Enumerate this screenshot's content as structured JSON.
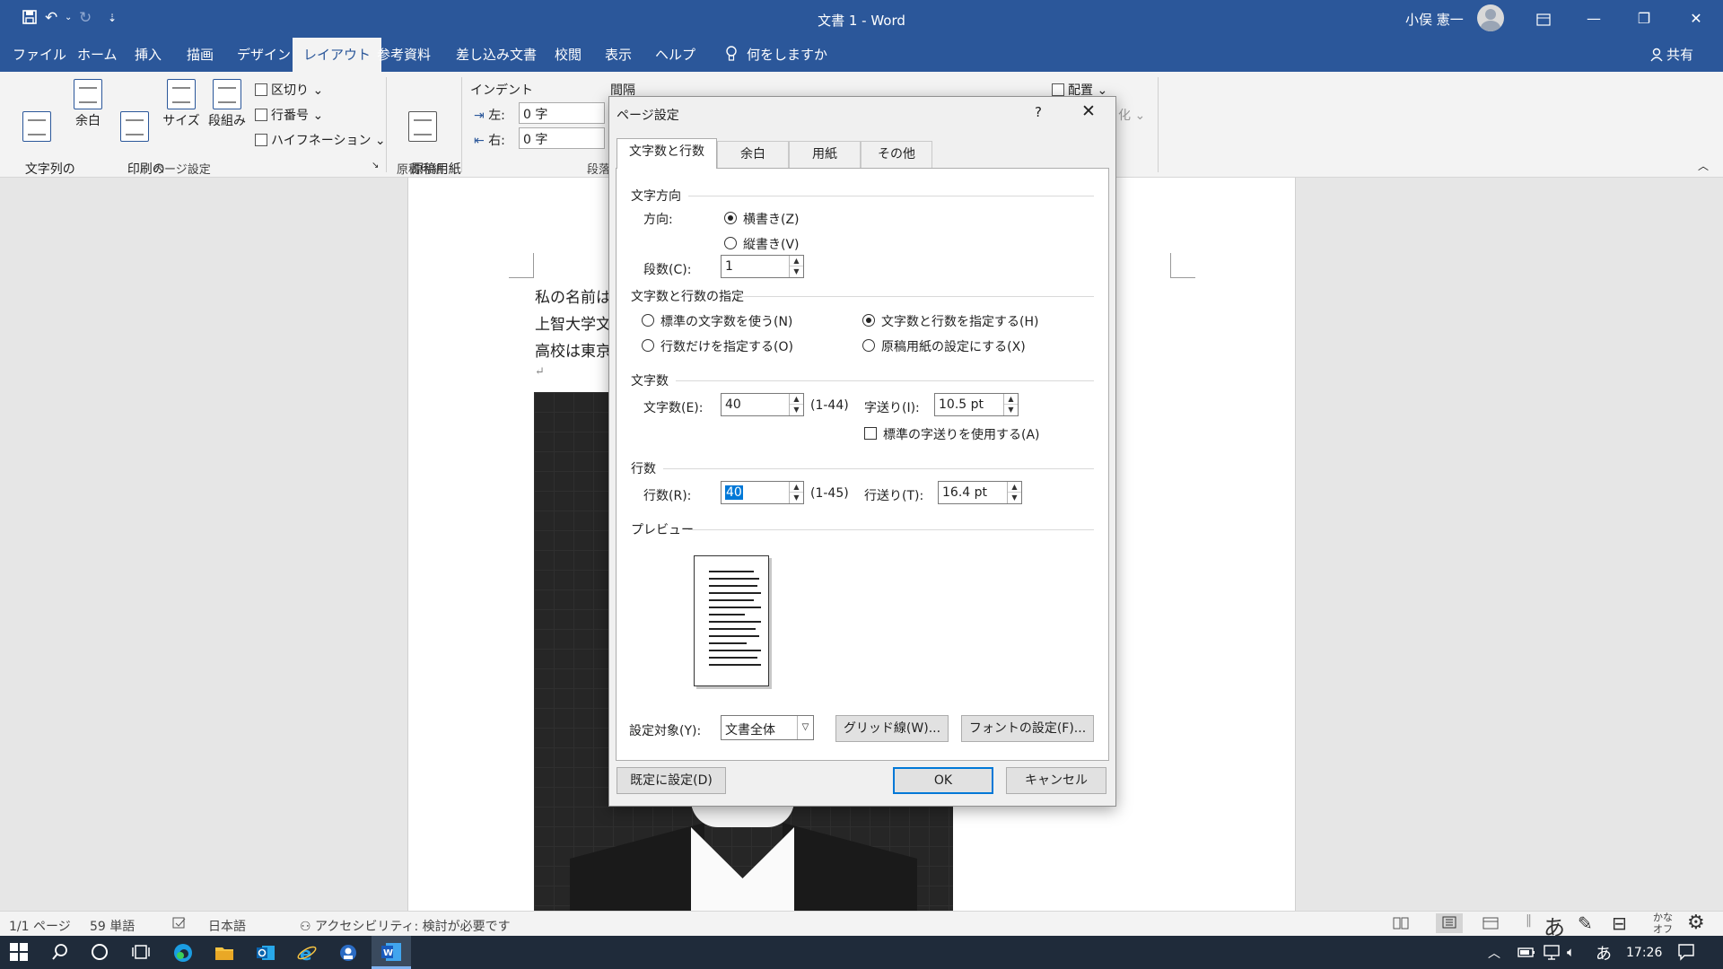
{
  "titlebar": {
    "doc_title": "文書 1  -  Word",
    "user_name": "小俣 憲一",
    "undo_glyph": "↶",
    "redo_glyph": "↻",
    "customize_glyph": "⇣"
  },
  "tabs": [
    "ファイル",
    "ホーム",
    "挿入",
    "描画",
    "デザイン",
    "レイアウト",
    "参考資料",
    "差し込み文書",
    "校閲",
    "表示",
    "ヘルプ"
  ],
  "active_tab": "レイアウト",
  "tell_me": "何をしますか",
  "share_label": "共有",
  "ribbon": {
    "text_direction": "文字列の\n方向",
    "margins": "余白",
    "orientation": "印刷の\n向き",
    "size": "サイズ",
    "columns": "段組み",
    "breaks": "区切り",
    "line_numbers": "行番号",
    "hyphenation": "ハイフネーション",
    "page_setup_group": "ページ設定",
    "genko": "原稿用紙\n設定",
    "genko_group": "原稿用紙",
    "indent_header": "インデント",
    "indent_left_label": "左:",
    "indent_left_value": "0 字",
    "indent_right_label": "右:",
    "indent_right_value": "0 字",
    "spacing_header": "間隔",
    "paragraph_group": "段落",
    "arrange": "配置",
    "ka": "化"
  },
  "document": {
    "lines": [
      "私の名前は",
      "上智大学文",
      "高校は東京"
    ],
    "para_mark": "↵"
  },
  "dialog": {
    "title": "ページ設定",
    "help": "?",
    "close": "✕",
    "tabs": [
      "文字数と行数",
      "余白",
      "用紙",
      "その他"
    ],
    "text_direction": {
      "header": "文字方向",
      "direction_label": "方向:",
      "horizontal": "横書き(Z)",
      "vertical": "縦書き(V)",
      "selected": "横書き(Z)",
      "columns_label": "段数(C):",
      "columns_value": "1"
    },
    "grid": {
      "header": "文字数と行数の指定",
      "opt_standard": "標準の文字数を使う(N)",
      "opt_chars_lines": "文字数と行数を指定する(H)",
      "opt_lines_only": "行数だけを指定する(O)",
      "opt_genko": "原稿用紙の設定にする(X)",
      "selected": "文字数と行数を指定する(H)"
    },
    "chars": {
      "header": "文字数",
      "chars_label": "文字数(E):",
      "chars_value": "40",
      "chars_range": "(1-44)",
      "pitch_label": "字送り(I):",
      "pitch_value": "10.5 pt",
      "use_standard_pitch": "標準の字送りを使用する(A)",
      "use_standard_pitch_checked": false
    },
    "lines": {
      "header": "行数",
      "lines_label": "行数(R):",
      "lines_value": "40",
      "lines_range": "(1-45)",
      "pitch_label": "行送り(T):",
      "pitch_value": "16.4 pt"
    },
    "preview_header": "プレビュー",
    "apply_to_label": "設定対象(Y):",
    "apply_to_value": "文書全体",
    "grid_button": "グリッド線(W)...",
    "font_button": "フォントの設定(F)...",
    "default_button": "既定に設定(D)",
    "ok_button": "OK",
    "cancel_button": "キャンセル"
  },
  "statusbar": {
    "page": "1/1 ページ",
    "words": "59 単語",
    "language": "日本語",
    "accessibility": "アクセシビリティ: 検討が必要です",
    "ime_mode": "あ",
    "kana": "かな\nオフ"
  },
  "taskbar": {
    "time": "17:26",
    "ime": "あ"
  },
  "colors": {
    "word_blue": "#2b579a",
    "selection": "#0078d7",
    "taskbar": "#1f2b3a"
  }
}
